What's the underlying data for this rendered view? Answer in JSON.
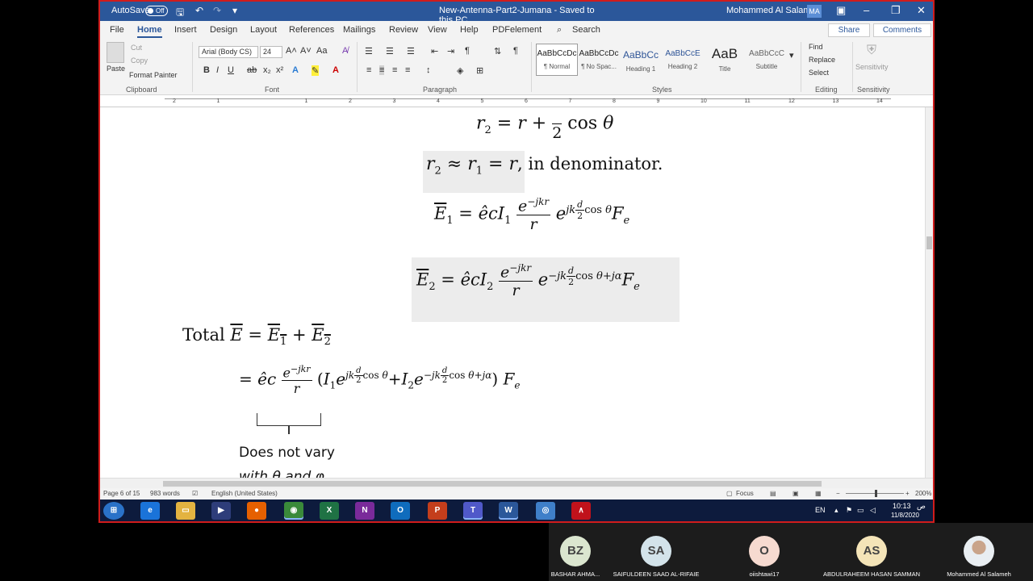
{
  "app": {
    "autosave_label": "AutoSave",
    "autosave_state": "Off",
    "document_title": "New-Antenna-Part2-Jumana - Saved to this PC",
    "user_name": "Mohammed Al Salameh",
    "user_initials": "MA"
  },
  "ribbon": {
    "tabs": [
      "File",
      "Home",
      "Insert",
      "Design",
      "Layout",
      "References",
      "Mailings",
      "Review",
      "View",
      "Help",
      "PDFelement"
    ],
    "active_tab": "Home",
    "search_label": "Search",
    "share_label": "Share",
    "comments_label": "Comments",
    "clipboard": {
      "paste": "Paste",
      "cut": "Cut",
      "copy": "Copy",
      "format_painter": "Format Painter",
      "group": "Clipboard"
    },
    "font": {
      "name": "Arial (Body CS)",
      "size": "24",
      "group": "Font"
    },
    "paragraph_group": "Paragraph",
    "styles": [
      {
        "preview": "AaBbCcDc",
        "name": "¶ Normal"
      },
      {
        "preview": "AaBbCcDc",
        "name": "¶ No Spac..."
      },
      {
        "preview": "AaBbCc",
        "name": "Heading 1"
      },
      {
        "preview": "AaBbCcE",
        "name": "Heading 2"
      },
      {
        "preview": "AaB",
        "name": "Title"
      },
      {
        "preview": "AaBbCcC",
        "name": "Subtitle"
      }
    ],
    "styles_group": "Styles",
    "editing": {
      "find": "Find",
      "replace": "Replace",
      "select": "Select",
      "group": "Editing"
    },
    "sensitivity": {
      "label": "Sensitivity",
      "group": "Sensitivity"
    }
  },
  "document": {
    "note_line1": "Does not vary",
    "note_line2": "with θ and φ",
    "denominator_text": ", in denominator.",
    "total_label": "Total"
  },
  "status": {
    "page": "Page 6 of 15",
    "words": "983 words",
    "language": "English (United States)",
    "focus": "Focus",
    "zoom": "200%"
  },
  "taskbar": {
    "lang": "EN",
    "time": "10:13",
    "am_pm": "ص",
    "date": "11/8/2020"
  },
  "participants": [
    {
      "initials": "BZ",
      "name": "BASHAR AHMA...",
      "color": "#dbe6cf"
    },
    {
      "initials": "SA",
      "name": "SAIFULDEEN SAAD AL-RIFAIE",
      "color": "#d3e3ea"
    },
    {
      "initials": "O",
      "name": "oiishtawi17",
      "color": "#f6dad0"
    },
    {
      "initials": "AS",
      "name": "ABDULRAHEEM HASAN SAMMAN",
      "color": "#f4e4b8"
    },
    {
      "initials": "",
      "name": "Mohammed Al Salameh",
      "color": "#e9eef2"
    }
  ]
}
